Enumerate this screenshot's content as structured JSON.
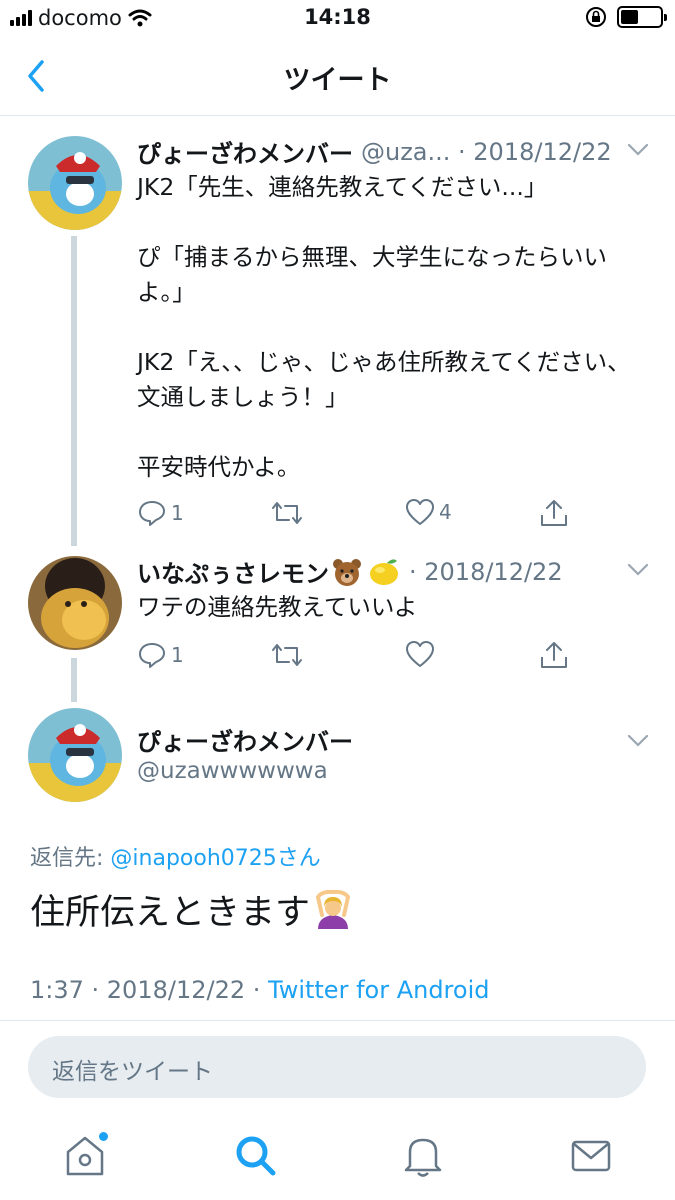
{
  "status_bar": {
    "carrier": "docomo",
    "time": "14:18",
    "battery_level": 0.4
  },
  "header": {
    "title": "ツイート"
  },
  "tweets": [
    {
      "name": "ぴょーざわメンバー",
      "meta": "@uza... · 2018/12/22",
      "text": "JK2「先生、連絡先教えてください...」\n\nぴ「捕まるから無理、大学生になったらいいよ。」\n\nJK2「え、、じゃ、じゃあ住所教えてください、文通しましょう！」\n\n平安時代かよ。",
      "reply_count": "1",
      "retweet_count": "",
      "like_count": "4"
    },
    {
      "name": "いなぷぅさレモン",
      "name_emoji": [
        "bear-emoji",
        "lemon-emoji"
      ],
      "meta": "· 2018/12/22",
      "text": "ワテの連絡先教えていいよ",
      "reply_count": "1",
      "retweet_count": "",
      "like_count": ""
    }
  ],
  "focused_tweet": {
    "name": "ぴょーざわメンバー",
    "handle": "@uzawwwwwwa",
    "reply_to_label": "返信先:",
    "reply_to_user": "@inapooh0725さん",
    "text": "住所伝えときます",
    "text_emoji": "person-gesturing-ok-emoji",
    "time_date": "1:37 · 2018/12/22 · ",
    "source": "Twitter for Android"
  },
  "reply_box": {
    "placeholder": "返信をツイート"
  },
  "tab_bar": {
    "items": [
      "home-icon",
      "search-icon",
      "notifications-icon",
      "messages-icon"
    ],
    "active": "search-icon"
  },
  "colors": {
    "accent": "#1da1f2",
    "secondary_text": "#657786",
    "thread_line": "#ccd6dd"
  }
}
